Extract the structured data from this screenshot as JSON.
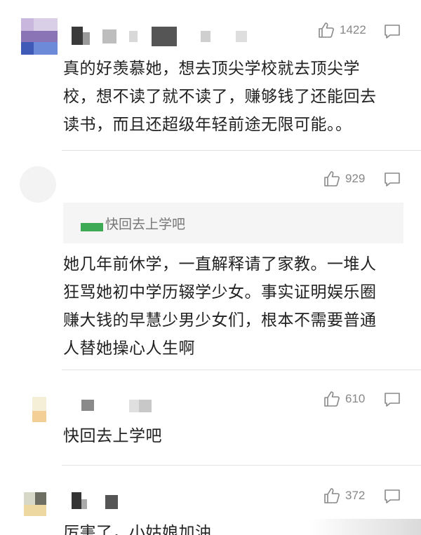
{
  "comments": [
    {
      "likes": "1422",
      "text": "真的好羡慕她，想去顶尖学校就去顶尖学校，想不读了就不读了，赚够钱了还能回去读书，而且还超级年轻前途无限可能。。",
      "lines": [
        "真的好羡慕她，想去顶尖学校就去顶尖学",
        "校，想不读了就不读了，赚够钱了还能回去",
        "读书，而且还超级年轻前途无限可能。。"
      ]
    },
    {
      "likes": "929",
      "quote": "快回去上学吧",
      "lines": [
        "她几年前休学，一直解释请了家教。一堆人",
        "狂骂她初中学历辍学少女。事实证明娱乐圈",
        "赚大钱的早慧少男少女们，根本不需要普通",
        "人替她操心人生啊"
      ]
    },
    {
      "likes": "610",
      "lines": [
        "快回去上学吧"
      ]
    },
    {
      "likes": "372",
      "lines": [
        "厉害了，小姑娘加油"
      ]
    }
  ],
  "icons": {
    "like": "thumbs-up-icon",
    "reply": "comment-bubble-icon"
  },
  "colors": {
    "text": "#222222",
    "meta": "#888888",
    "quote_bg": "#f5f5f5",
    "divider": "#e2e2e2"
  }
}
